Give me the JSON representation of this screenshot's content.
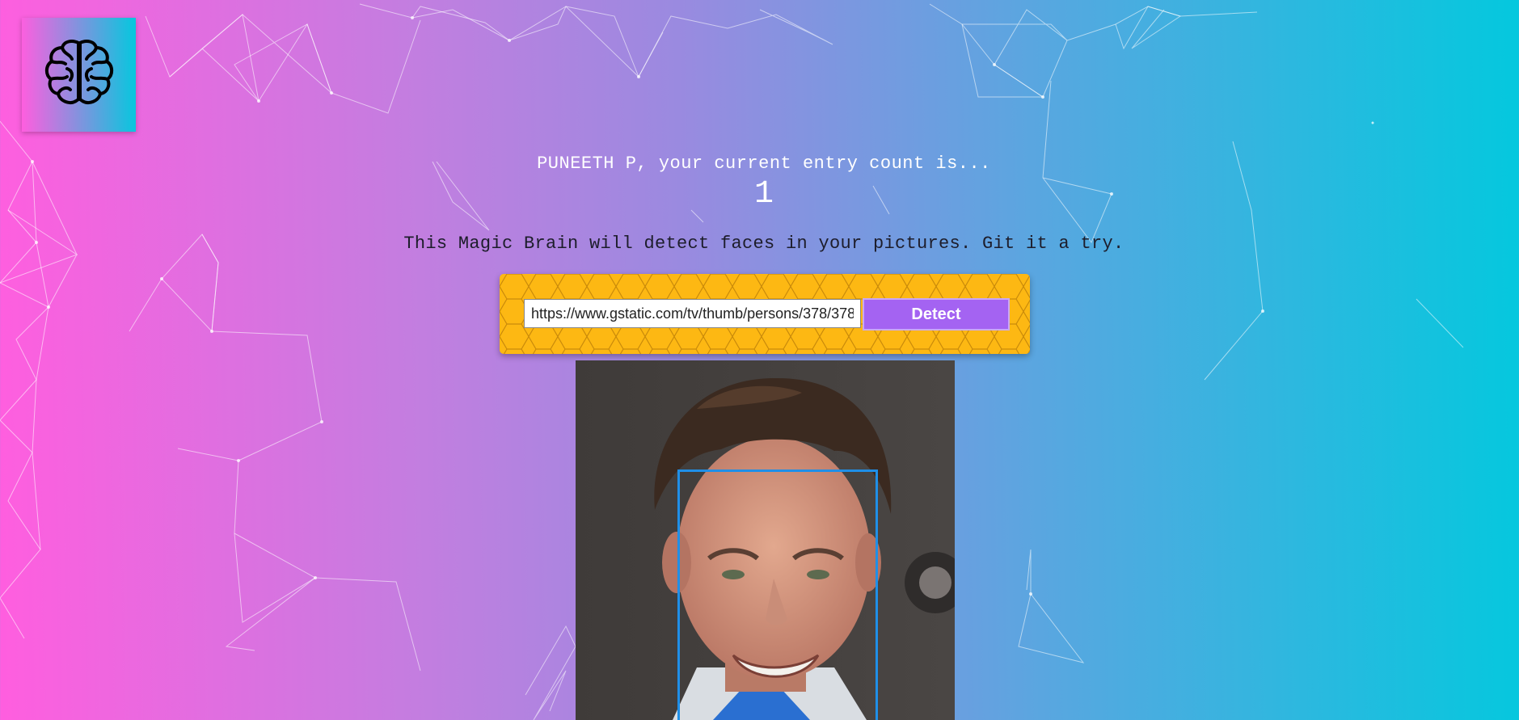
{
  "navigation": {
    "logo_icon": "brain-icon"
  },
  "rank": {
    "message": "PUNEETH P, your current entry count is...",
    "count": "1"
  },
  "intro": {
    "text": "This Magic Brain will detect faces in your pictures. Git it a try."
  },
  "form": {
    "url_value": "https://www.gstatic.com/tv/thumb/persons/378/378",
    "button_label": "Detect"
  },
  "image": {
    "subject": "portrait-photo",
    "face_box_color": "#1f8fe8"
  },
  "colors": {
    "gradient_left": "#ff5edf",
    "gradient_right": "#04c8de",
    "panel_yellow": "#fdb813",
    "button_purple": "#a463f2"
  }
}
